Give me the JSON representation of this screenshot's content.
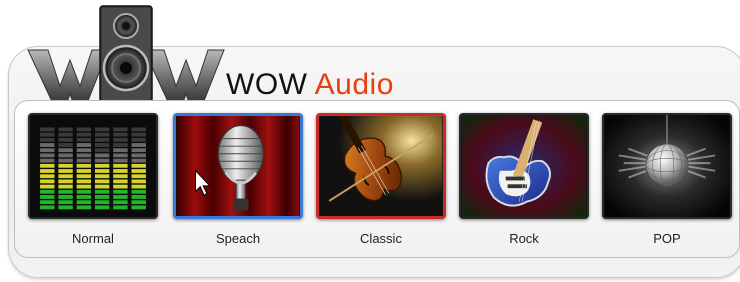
{
  "app": {
    "brand_prefix": "WOW",
    "brand_accent": "Audio",
    "accent_color": "#e8400d"
  },
  "presets": [
    {
      "label": "Normal",
      "icon": "equalizer-icon"
    },
    {
      "label": "Speach",
      "icon": "microphone-icon"
    },
    {
      "label": "Classic",
      "icon": "violin-icon"
    },
    {
      "label": "Rock",
      "icon": "electric-guitar-icon"
    },
    {
      "label": "POP",
      "icon": "disco-ball-icon"
    }
  ]
}
